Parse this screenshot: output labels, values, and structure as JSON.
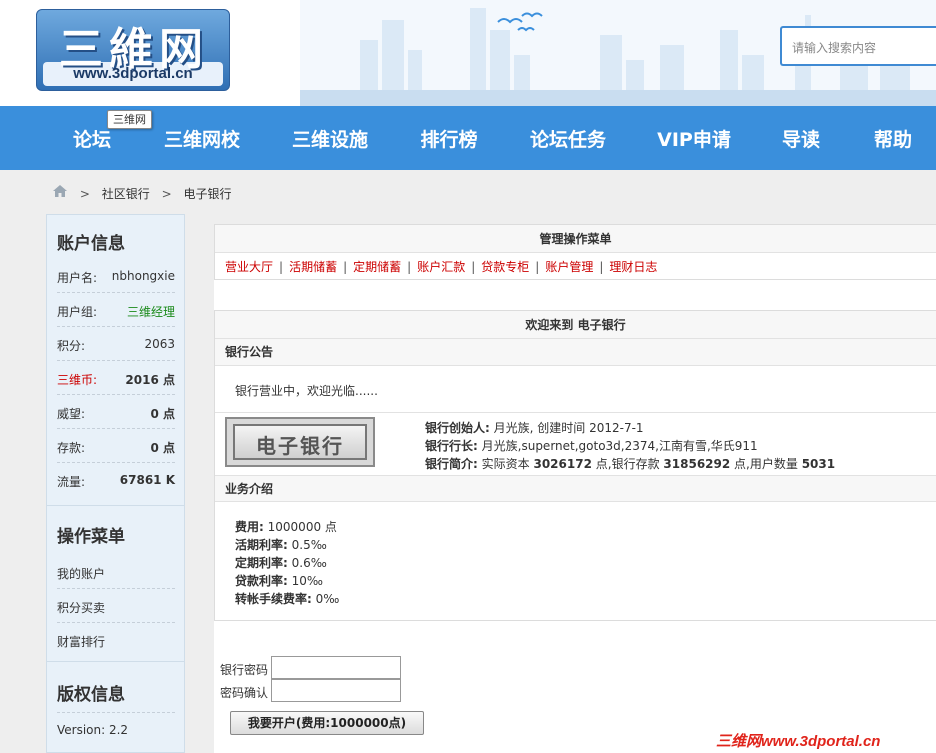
{
  "site": {
    "logo_text": "三維网",
    "logo_url": "www.3dportal.cn",
    "search_placeholder": "请输入搜索内容",
    "tooltip": "三维网"
  },
  "nav": {
    "items": [
      {
        "label": "论坛"
      },
      {
        "label": "三维网校"
      },
      {
        "label": "三维设施"
      },
      {
        "label": "排行榜"
      },
      {
        "label": "论坛任务"
      },
      {
        "label": "VIP申请"
      },
      {
        "label": "导读"
      },
      {
        "label": "帮助"
      }
    ]
  },
  "breadcrumb": {
    "sep": ">",
    "items": [
      "社区银行",
      "电子银行"
    ]
  },
  "sidebar": {
    "account_title": "账户信息",
    "account_rows": [
      {
        "key": "用户名:",
        "value": "nbhongxie"
      },
      {
        "key": "用户组:",
        "value": "三维经理"
      },
      {
        "key": "积分:",
        "value": "2063"
      },
      {
        "key": "三维币:",
        "value": "2016 点"
      },
      {
        "key": "威望:",
        "value": "0 点"
      },
      {
        "key": "存款:",
        "value": "0 点"
      },
      {
        "key": "流量:",
        "value": "67861 K"
      }
    ],
    "menu_title": "操作菜单",
    "menu_items": [
      "我的账户",
      "积分买卖",
      "财富排行"
    ],
    "copyright_title": "版权信息",
    "version": "Version: 2.2"
  },
  "main": {
    "menu_head": "管理操作菜单",
    "menu_links": [
      "营业大厅",
      "活期储蓄",
      "定期储蓄",
      "账户汇款",
      "贷款专柜",
      "账户管理",
      "理财日志"
    ],
    "menu_sep": "|",
    "welcome": "欢迎来到 电子银行",
    "notice_head": "银行公告",
    "notice_text": "银行营业中，欢迎光临......",
    "bank_image_text": "电子银行",
    "founder_label": "银行创始人:",
    "founder_value": "月光族, 创建时间 2012-7-1",
    "president_label": "银行行长:",
    "president_value": "月光族,supernet,goto3d,2374,江南有雪,华氏911",
    "intro_label": "银行简介:",
    "intro_t1": "实际资本",
    "intro_capital": "3026172",
    "intro_t2": "点,银行存款",
    "intro_deposit": "31856292",
    "intro_t3": "点,用户数量",
    "intro_users": "5031",
    "business_head": "业务介绍",
    "fees": [
      {
        "label": "费用:",
        "value": "1000000 点"
      },
      {
        "label": "活期利率:",
        "value": "0.5‰"
      },
      {
        "label": "定期利率:",
        "value": "0.6‰"
      },
      {
        "label": "贷款利率:",
        "value": "10‰"
      },
      {
        "label": "转帐手续费率:",
        "value": "0‰"
      }
    ],
    "password_label": "银行密码",
    "confirm_label": "密码确认",
    "open_button": "我要开户(费用:1000000点)"
  },
  "watermark": "三维网www.3dportal.cn",
  "colors": {
    "nav_bg": "#3a8fdc",
    "link_red": "#cc0000",
    "group_green": "#1a8a1a"
  }
}
